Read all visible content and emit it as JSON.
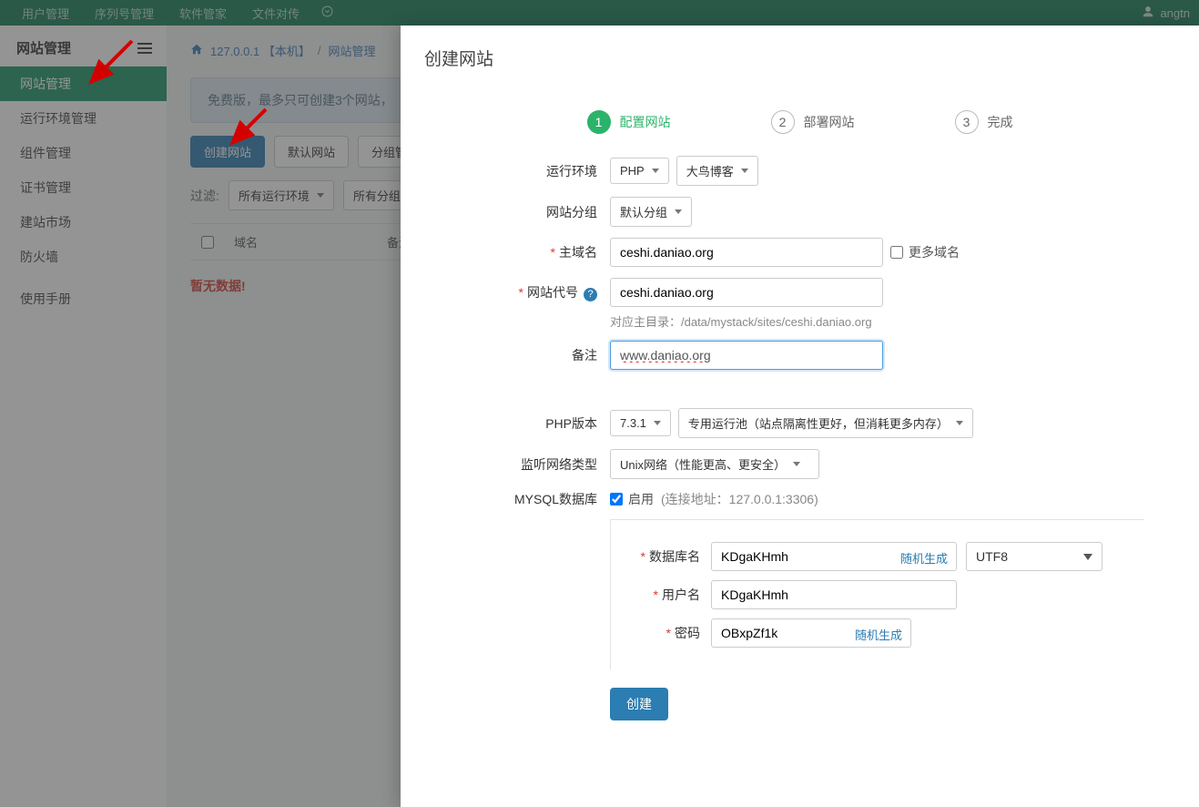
{
  "topnav": {
    "items": [
      "用户管理",
      "序列号管理",
      "软件管家",
      "文件对传"
    ],
    "username": "angtn"
  },
  "sidebar": {
    "title": "网站管理",
    "items": [
      "网站管理",
      "运行环境管理",
      "组件管理",
      "证书管理",
      "建站市场",
      "防火墙"
    ],
    "footer": "使用手册"
  },
  "breadcrumb": {
    "host": "127.0.0.1 【本机】",
    "section": "网站管理"
  },
  "notice": "免费版，最多只可创建3个网站，",
  "btns": {
    "create": "创建网站",
    "default": "默认网站",
    "group": "分组管理"
  },
  "filter": {
    "label": "过滤:",
    "env": "所有运行环境",
    "group": "所有分组"
  },
  "table": {
    "cols": [
      "域名",
      "备注"
    ],
    "empty": "暂无数据!"
  },
  "modal": {
    "title": "创建网站",
    "steps": [
      "配置网站",
      "部署网站",
      "完成"
    ],
    "labels": {
      "env": "运行环境",
      "group": "网站分组",
      "domain": "主域名",
      "more_domains": "更多域名",
      "code": "网站代号",
      "note": "备注",
      "php_ver": "PHP版本",
      "net_type": "监听网络类型",
      "mysql": "MYSQL数据库",
      "enable": "启用",
      "conn_hint": "(连接地址：127.0.0.1:3306)",
      "db_name": "数据库名",
      "db_user": "用户名",
      "db_pass": "密码",
      "gen": "随机生成",
      "create": "创建"
    },
    "values": {
      "env_php": "PHP",
      "env_blog": "大鸟博客",
      "group_default": "默认分组",
      "domain": "ceshi.daniao.org",
      "code": "ceshi.daniao.org",
      "dir_hint": "对应主目录：/data/mystack/sites/ceshi.daniao.org",
      "note": "www.daniao.org",
      "php_ver": "7.3.1",
      "php_pool": "专用运行池（站点隔离性更好，但消耗更多内存）",
      "net_type": "Unix网络（性能更高、更安全）",
      "db_name": "KDgaKHmh",
      "db_user": "KDgaKHmh",
      "db_pass": "OBxpZf1k",
      "encoding": "UTF8"
    }
  }
}
